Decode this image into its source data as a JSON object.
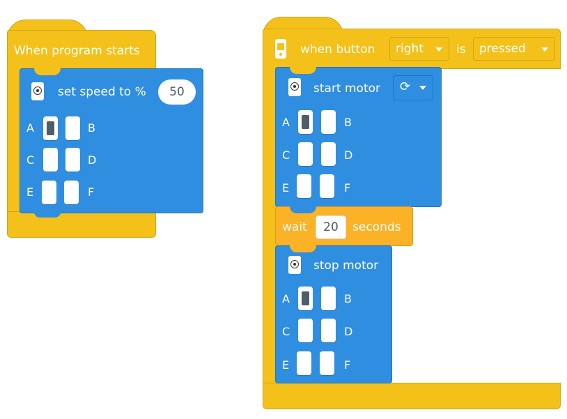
{
  "program1": {
    "hat_label": "When program starts",
    "speed_block": {
      "label": "set speed to %",
      "value": "50"
    },
    "ports": [
      [
        "A",
        "B"
      ],
      [
        "C",
        "D"
      ],
      [
        "E",
        "F"
      ]
    ]
  },
  "program2": {
    "hat_when": "when button",
    "hat_button": "right",
    "hat_is": "is",
    "hat_state": "pressed",
    "start_motor": {
      "label": "start motor",
      "direction_icon": "clockwise-icon"
    },
    "wait": {
      "label_before": "wait",
      "value": "20",
      "label_after": "seconds"
    },
    "stop_motor": {
      "label": "stop motor"
    },
    "ports": [
      [
        "A",
        "B"
      ],
      [
        "C",
        "D"
      ],
      [
        "E",
        "F"
      ]
    ]
  },
  "colors": {
    "event_yellow": "#f4c11a",
    "motor_blue": "#2f8ee0",
    "control_orange": "#fbb226"
  }
}
